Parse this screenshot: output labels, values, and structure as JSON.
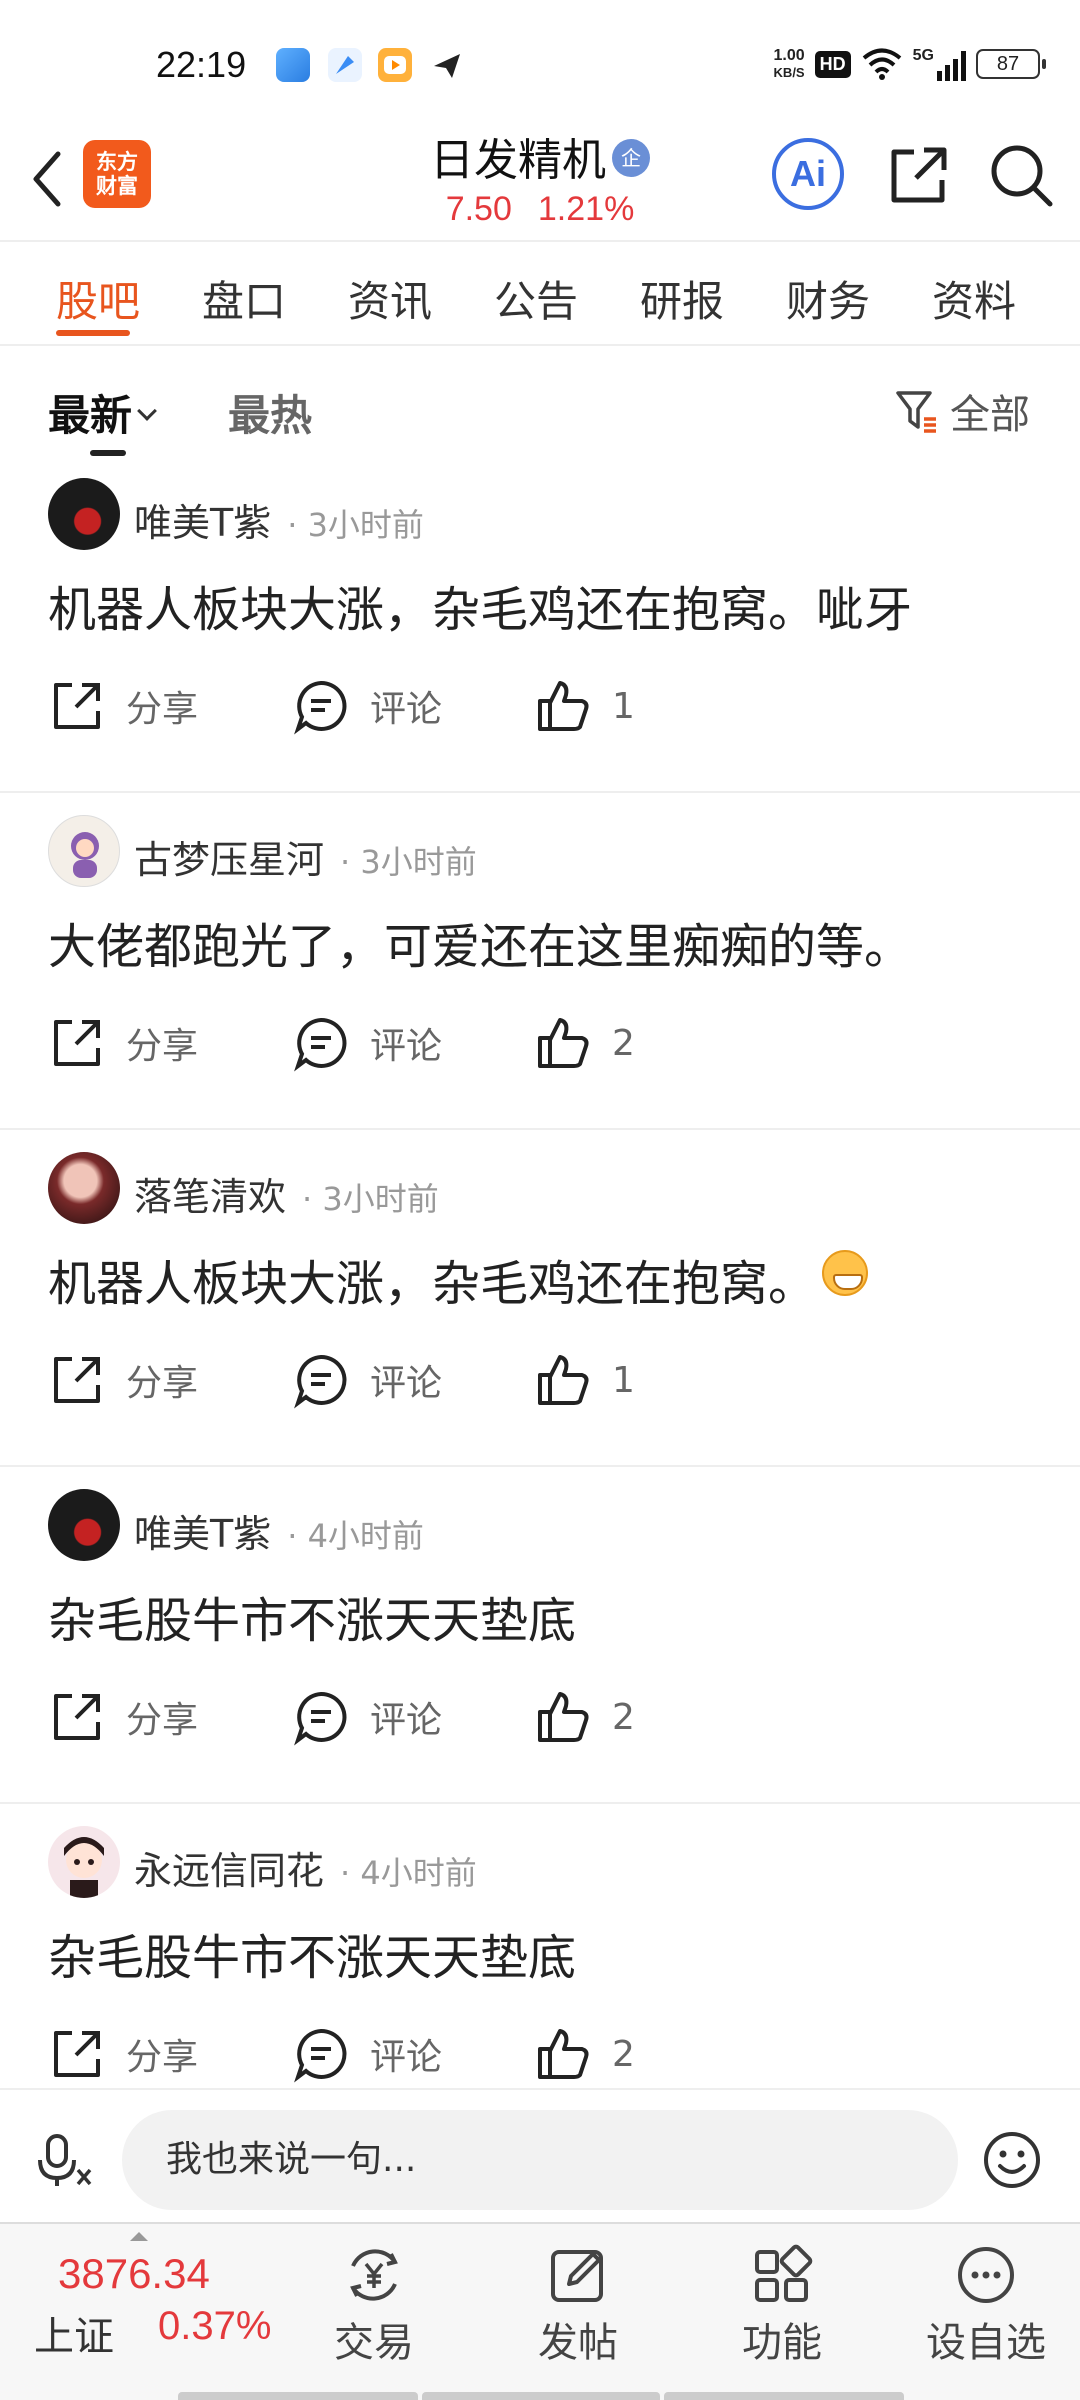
{
  "status_bar": {
    "time": "22:19",
    "net_speed_value": "1.00",
    "net_speed_unit": "KB/S",
    "hd": "HD",
    "network": "5G",
    "battery": "87"
  },
  "header": {
    "stock_name": "日发精机",
    "badge": "企",
    "brand_line1": "东方",
    "brand_line2": "财富",
    "price": "7.50",
    "change_pct": "1.21%",
    "ai_label": "Ai",
    "price_color": "#e4393c"
  },
  "tabs": [
    {
      "label": "股吧",
      "active": true
    },
    {
      "label": "盘口"
    },
    {
      "label": "资讯"
    },
    {
      "label": "公告"
    },
    {
      "label": "研报"
    },
    {
      "label": "财务"
    },
    {
      "label": "资料"
    }
  ],
  "sort": {
    "latest": "最新",
    "hot": "最热",
    "filter": "全部"
  },
  "posts": [
    {
      "user": "唯美T紫",
      "time": "· 3小时前",
      "text": "机器人板块大涨，杂毛鸡还在抱窝。呲牙",
      "share": "分享",
      "comment": "评论",
      "likes": "1"
    },
    {
      "user": "古梦压星河",
      "time": "· 3小时前",
      "text": "大佬都跑光了，可爱还在这里痴痴的等。",
      "share": "分享",
      "comment": "评论",
      "likes": "2"
    },
    {
      "user": "落笔清欢",
      "time": "· 3小时前",
      "text": "机器人板块大涨，杂毛鸡还在抱窝。",
      "share": "分享",
      "comment": "评论",
      "likes": "1",
      "emoji": "grinning-emoji"
    },
    {
      "user": "唯美T紫",
      "time": "· 4小时前",
      "text": "杂毛股牛市不涨天天垫底",
      "share": "分享",
      "comment": "评论",
      "likes": "2"
    },
    {
      "user": "永远信同花",
      "time": "· 4小时前",
      "text": "杂毛股牛市不涨天天垫底",
      "share": "分享",
      "comment": "评论",
      "likes": "2"
    }
  ],
  "comment_bar": {
    "placeholder": "我也来说一句..."
  },
  "bottom_bar": {
    "index_value": "3876.34",
    "index_name": "上证",
    "index_pct": "0.37%",
    "nav": [
      {
        "label": "交易",
        "icon": "trade-icon"
      },
      {
        "label": "发帖",
        "icon": "post-edit-icon"
      },
      {
        "label": "功能",
        "icon": "grid-icon"
      },
      {
        "label": "设自选",
        "icon": "more-icon"
      }
    ]
  },
  "colors": {
    "accent": "#e8551e",
    "up_red": "#e4393c",
    "ai_blue": "#3b6ee0"
  }
}
